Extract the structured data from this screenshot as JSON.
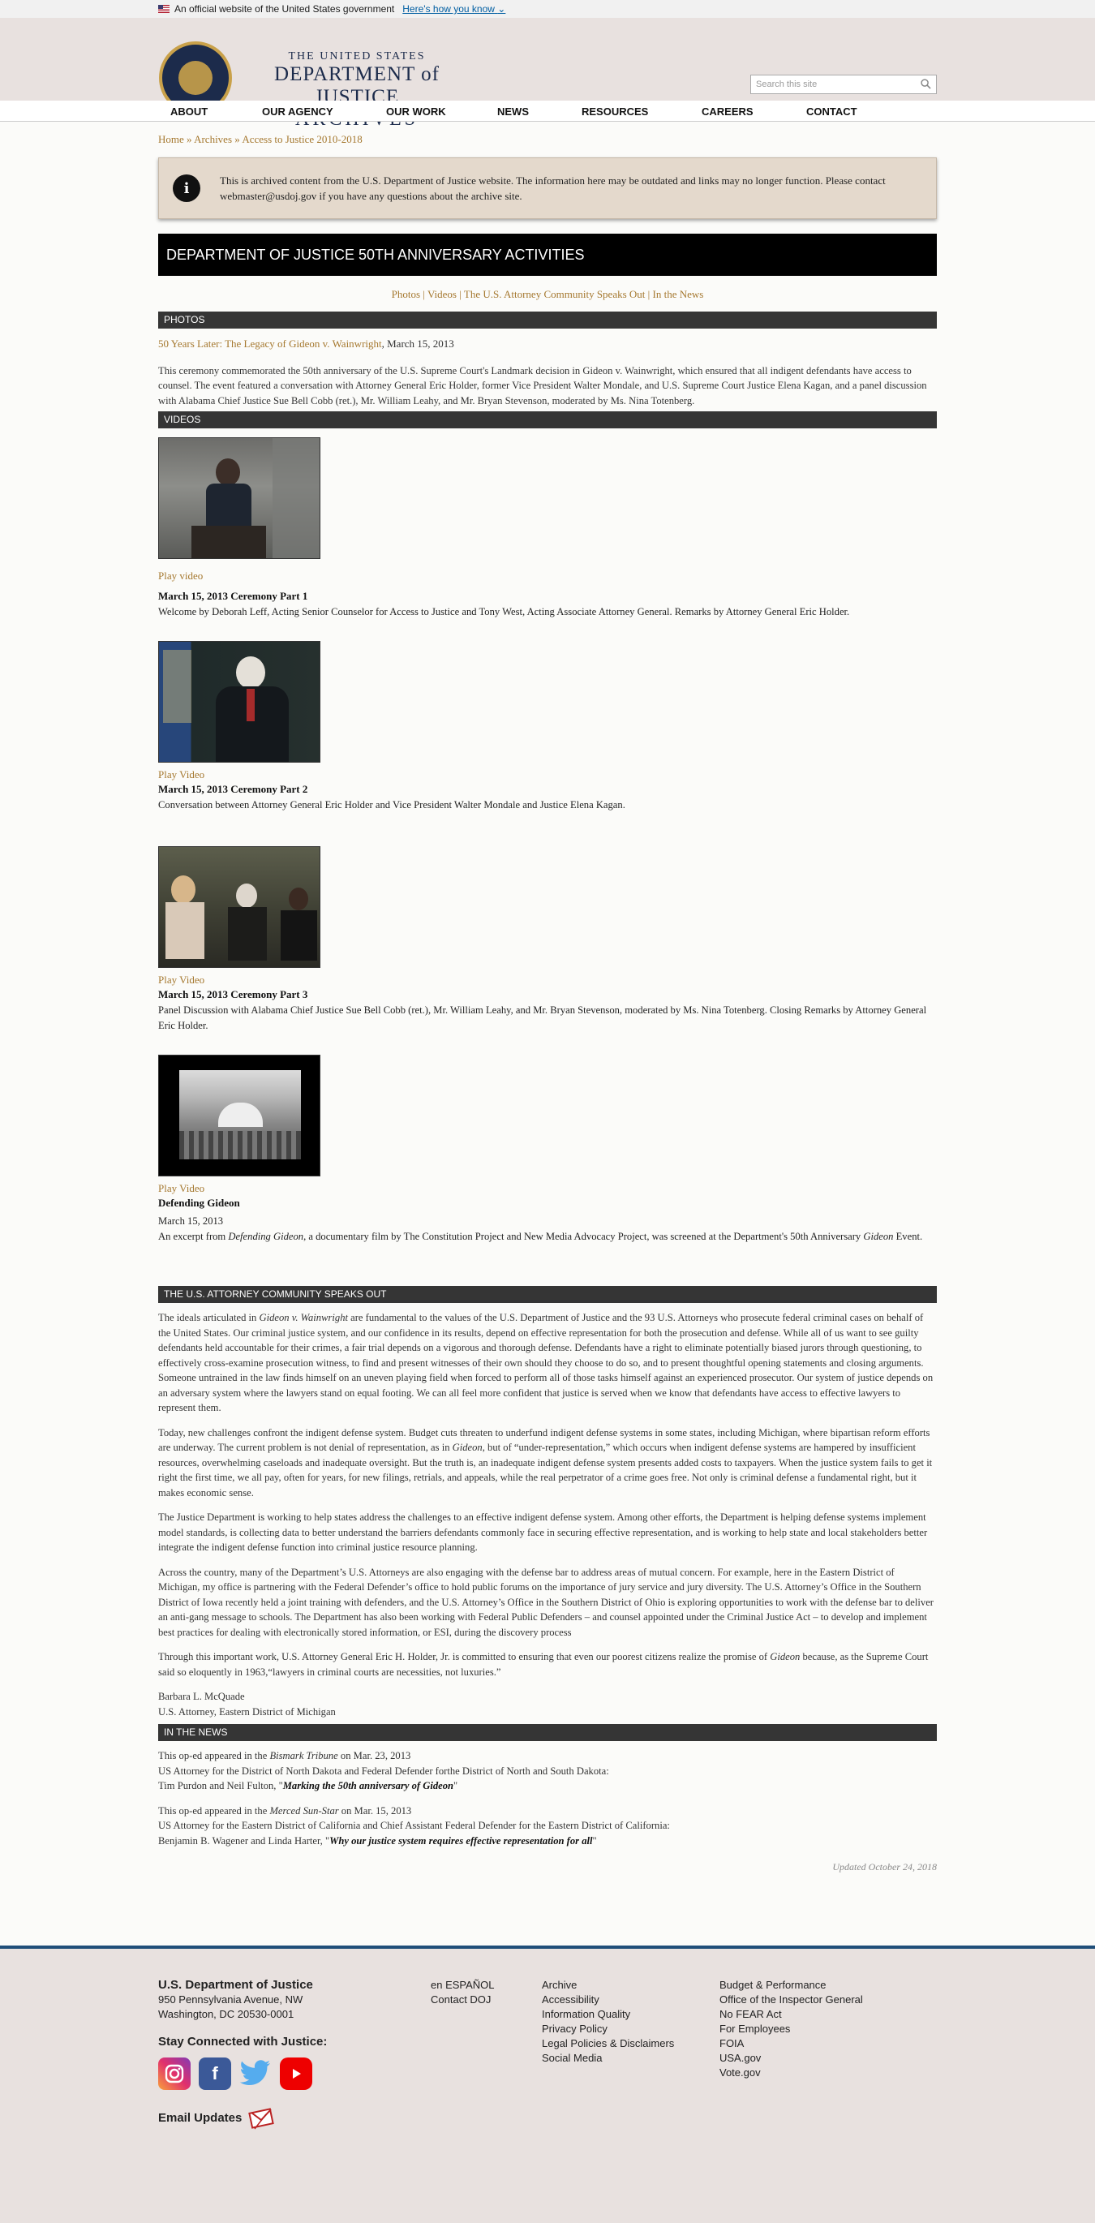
{
  "gov_banner": {
    "text": "An official website of the United States government",
    "link": "Here's how you know"
  },
  "logo": {
    "line1": "THE UNITED STATES",
    "line2": "DEPARTMENT of JUSTICE",
    "line3": "ARCHIVES"
  },
  "search": {
    "placeholder": "Search this site"
  },
  "nav": [
    "ABOUT",
    "OUR AGENCY",
    "OUR WORK",
    "NEWS",
    "RESOURCES",
    "CAREERS",
    "CONTACT"
  ],
  "breadcrumb": {
    "home": "Home",
    "archives": "Archives",
    "current": "Access to Justice 2010-2018",
    "sep": " » "
  },
  "notice": "This is archived content from the U.S. Department of Justice website. The information here may be outdated and links may no longer function. Please contact webmaster@usdoj.gov if you have any questions about the archive site.",
  "page_title": "DEPARTMENT OF JUSTICE 50TH ANNIVERSARY ACTIVITIES",
  "subnav": {
    "photos": "Photos",
    "videos": "Videos",
    "speaks_out": "The U.S. Attorney Community Speaks Out",
    "news": "In the News",
    "sep": " | "
  },
  "photos": {
    "heading": "PHOTOS",
    "link": "50 Years Later: The Legacy of Gideon v. Wainwright",
    "date": ", March 15, 2013",
    "body": "This ceremony commemorated the 50th anniversary of the U.S. Supreme Court's Landmark decision in Gideon v. Wainwright, which ensured that all indigent defendants have access to counsel. The event featured a conversation with Attorney General Eric Holder, former Vice President Walter Mondale, and U.S. Supreme Court Justice Elena Kagan, and a panel discussion with Alabama Chief Justice Sue Bell Cobb (ret.), Mr. William Leahy, and Mr. Bryan Stevenson, moderated by Ms. Nina Totenberg."
  },
  "videos": {
    "heading": "VIDEOS",
    "items": [
      {
        "link": "Play video",
        "title": "March 15, 2013 Ceremony Part 1",
        "date": "",
        "desc": "Welcome by Deborah Leff, Acting Senior Counselor for Access to Justice and Tony West, Acting Associate Attorney General. Remarks by Attorney General Eric Holder."
      },
      {
        "link": "Play Video",
        "title": "March 15, 2013 Ceremony Part 2",
        "date": "",
        "desc": "Conversation between Attorney General Eric Holder and Vice President Walter Mondale and Justice Elena Kagan."
      },
      {
        "link": "Play Video",
        "title": "March 15, 2013 Ceremony Part 3",
        "date": "",
        "desc": "Panel Discussion with Alabama Chief Justice Sue Bell Cobb (ret.), Mr. William Leahy, and Mr. Bryan Stevenson, moderated by Ms. Nina Totenberg. Closing Remarks by Attorney General Eric Holder."
      },
      {
        "link": "Play Video",
        "title": "Defending Gideon",
        "date": "March 15, 2013",
        "desc_pre": "An excerpt from ",
        "desc_em": "Defending Gideon",
        "desc_mid": ", a documentary film by The Constitution Project and New Media Advocacy Project, was screened at the Department's 50th Anniversary ",
        "desc_em2": "Gideon",
        "desc_post": " Event."
      }
    ]
  },
  "speaks_out": {
    "heading": "THE U.S. ATTORNEY COMMUNITY SPEAKS OUT",
    "p1_pre": "The ideals articulated in ",
    "p1_em": "Gideon v. Wainwright",
    "p1_post": " are fundamental to the values of the U.S. Department of Justice and the 93 U.S. Attorneys who prosecute federal criminal cases on behalf of the United States. Our criminal justice system, and our confidence in its results, depend on effective representation for both the prosecution and defense. While all of us want to see guilty defendants held accountable for their crimes, a fair trial depends on a vigorous and thorough defense. Defendants have a right to eliminate potentially biased jurors through questioning, to effectively cross-examine prosecution witness, to find and present witnesses of their own should they choose to do so, and to present thoughtful opening statements and closing arguments. Someone untrained in the law finds himself on an uneven playing field when forced to perform all of those tasks himself against an experienced prosecutor. Our system of justice depends on an adversary system where the lawyers stand on equal footing. We can all feel more confident that justice is served when we know that defendants have access to effective lawyers to represent them.",
    "p2_pre": "Today, new challenges confront the indigent defense system. Budget cuts threaten to underfund indigent defense systems in some states, including Michigan, where bipartisan reform efforts are underway. The current problem is not denial of representation, as in ",
    "p2_em": "Gideon",
    "p2_post": ", but of “under-representation,” which occurs when indigent defense systems are hampered by insufficient resources, overwhelming caseloads and inadequate oversight. But the truth is, an inadequate indigent defense system presents added costs to taxpayers. When the justice system fails to get it right the first time, we all pay, often for years, for new filings, retrials, and appeals, while the real perpetrator of a crime goes free. Not only is criminal defense a fundamental right, but it makes economic sense.",
    "p3": "The Justice Department is working to help states address the challenges to an effective indigent defense system. Among other efforts, the Department is helping defense systems implement model standards, is collecting data to better understand the barriers defendants commonly face in securing effective representation, and is working to help state and local stakeholders better integrate the indigent defense function into criminal justice resource planning.",
    "p4": "Across the country, many of the Department’s U.S. Attorneys are also engaging with the defense bar to address areas of mutual concern. For example, here in the Eastern District of Michigan, my office is partnering with the Federal Defender’s office to hold public forums on the importance of jury service and jury diversity. The U.S. Attorney’s Office in the Southern District of Iowa recently held a joint training with defenders, and the U.S. Attorney’s Office in the Southern District of Ohio is exploring opportunities to work with the defense bar to deliver an anti-gang message to schools. The Department has also been working with Federal Public Defenders – and counsel appointed under the Criminal Justice Act – to develop and implement best practices for dealing with electronically stored information, or ESI, during the discovery process",
    "p5_pre": "Through this important work, U.S. Attorney General Eric H. Holder, Jr. is committed to ensuring that even our poorest citizens realize the promise of ",
    "p5_em": "Gideon",
    "p5_post": " because, as the Supreme Court said so eloquently in 1963,“lawyers in criminal courts are necessities, not luxuries.”",
    "sig_name": "Barbara L. McQuade",
    "sig_title": "U.S. Attorney, Eastern District of Michigan"
  },
  "news": {
    "heading": "IN THE NEWS",
    "items": [
      {
        "l1_pre": "This op-ed appeared in the ",
        "l1_em": "Bismark Tribune",
        "l1_post": " on Mar. 23, 2013",
        "l2": "US Attorney for the District of North Dakota and Federal Defender forthe District of North and South Dakota:",
        "l3_pre": "Tim Purdon and Neil Fulton, \"",
        "l3_link": "Marking the 50th anniversary of Gideon",
        "l3_post": "\""
      },
      {
        "l1_pre": "This op-ed appeared in the ",
        "l1_em": "Merced Sun-Star",
        "l1_post": " on Mar. 15, 2013",
        "l2": "US Attorney for the Eastern District of California and Chief Assistant Federal Defender for the Eastern District of California:",
        "l3_pre": "Benjamin B. Wagener and Linda Harter, \"",
        "l3_link": "Why our justice system requires effective representation for all",
        "l3_post": "\""
      }
    ],
    "updated": "Updated October 24, 2018"
  },
  "footer": {
    "org": "U.S. Department of Justice",
    "addr1": "950 Pennsylvania Avenue, NW",
    "addr2": "Washington, DC 20530-0001",
    "stay": "Stay Connected with Justice:",
    "email": "Email Updates",
    "col2": [
      "en ESPAÑOL",
      "Contact DOJ"
    ],
    "col3": [
      "Archive",
      "Accessibility",
      "Information Quality",
      "Privacy Policy",
      "Legal Policies & Disclaimers",
      "Social Media"
    ],
    "col4": [
      "Budget & Performance",
      "Office of the Inspector General",
      "No FEAR Act",
      "For Employees",
      "FOIA",
      "USA.gov",
      "Vote.gov"
    ]
  }
}
